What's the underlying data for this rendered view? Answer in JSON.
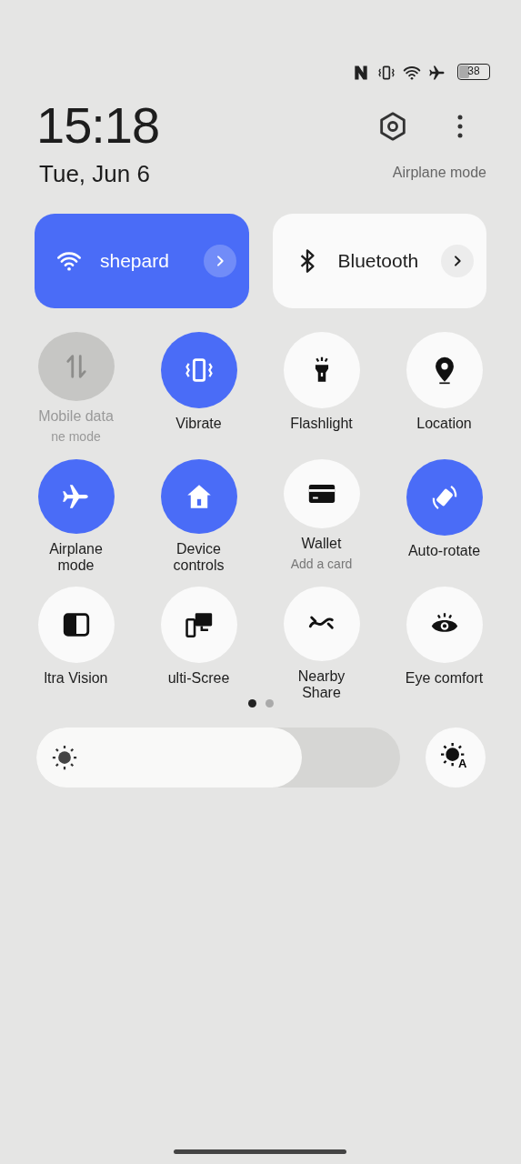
{
  "status_bar": {
    "battery": "38"
  },
  "clock": {
    "time": "15:18",
    "date": "Tue, Jun 6"
  },
  "header": {
    "mode_text": "Airplane mode"
  },
  "big_tiles": [
    {
      "kind": "wifi",
      "label": "shepard",
      "on": true
    },
    {
      "kind": "bluetooth",
      "label": "Bluetooth",
      "on": false
    }
  ],
  "tiles": [
    {
      "kind": "data",
      "label": "Mobile data",
      "sublabel": "ne mode",
      "disabled": true
    },
    {
      "kind": "vibrate",
      "label": "Vibrate",
      "on": true,
      "disabled": false
    },
    {
      "kind": "flashlight",
      "label": "Flashlight",
      "on": false,
      "disabled": false
    },
    {
      "kind": "location",
      "label": "Location",
      "on": false,
      "disabled": false
    },
    {
      "kind": "airplane",
      "label": "Airplane\nmode",
      "on": true,
      "disabled": false
    },
    {
      "kind": "home",
      "label": "Device\ncontrols",
      "on": true,
      "disabled": false
    },
    {
      "kind": "wallet",
      "label": "Wallet",
      "sublabel": "Add a card",
      "on": false,
      "disabled": false
    },
    {
      "kind": "rotate",
      "label": "Auto-rotate",
      "on": true,
      "disabled": false
    },
    {
      "kind": "split",
      "label": "ltra Vision",
      "on": false,
      "disabled": false
    },
    {
      "kind": "screens",
      "label": "ulti-Scree",
      "on": false,
      "disabled": false
    },
    {
      "kind": "share",
      "label": "Nearby\nShare",
      "on": false,
      "disabled": false
    },
    {
      "kind": "eye",
      "label": "Eye comfort",
      "on": false,
      "disabled": false
    }
  ],
  "pages": [
    {
      "selected": true
    },
    {
      "selected": false
    }
  ],
  "brightness": {
    "level": 0.73,
    "auto_badge": "A"
  }
}
